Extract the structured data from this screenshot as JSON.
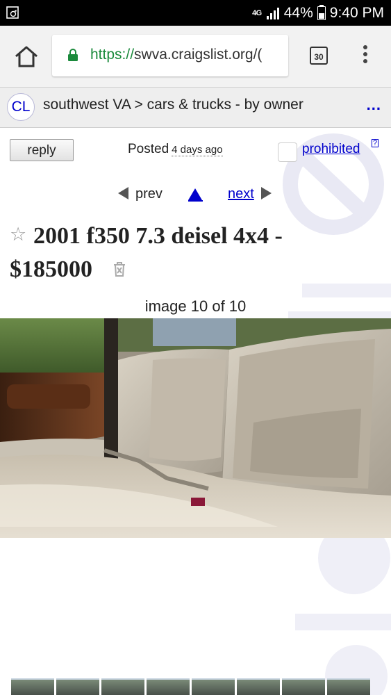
{
  "status_bar": {
    "network": "4G",
    "battery": "44%",
    "time": "9:40 PM"
  },
  "browser": {
    "url_scheme": "https://",
    "url_rest": "swva.craigslist.org/(",
    "tab_count": "30"
  },
  "header": {
    "logo": "CL",
    "breadcrumb": "southwest VA > cars & trucks - by owner",
    "more": "..."
  },
  "post": {
    "reply_label": "reply",
    "posted_label": "Posted",
    "posted_ago": "4 days ago",
    "prohibited_label": "prohibited",
    "help_mark": "?",
    "prev_label": "prev",
    "next_label": "next",
    "title": "2001 f350 7.3 deisel 4x4 -",
    "price": "$185000",
    "image_caption": "image 10 of 10"
  },
  "colors": {
    "link": "#0000cc",
    "url_green": "#1b8a3c"
  }
}
